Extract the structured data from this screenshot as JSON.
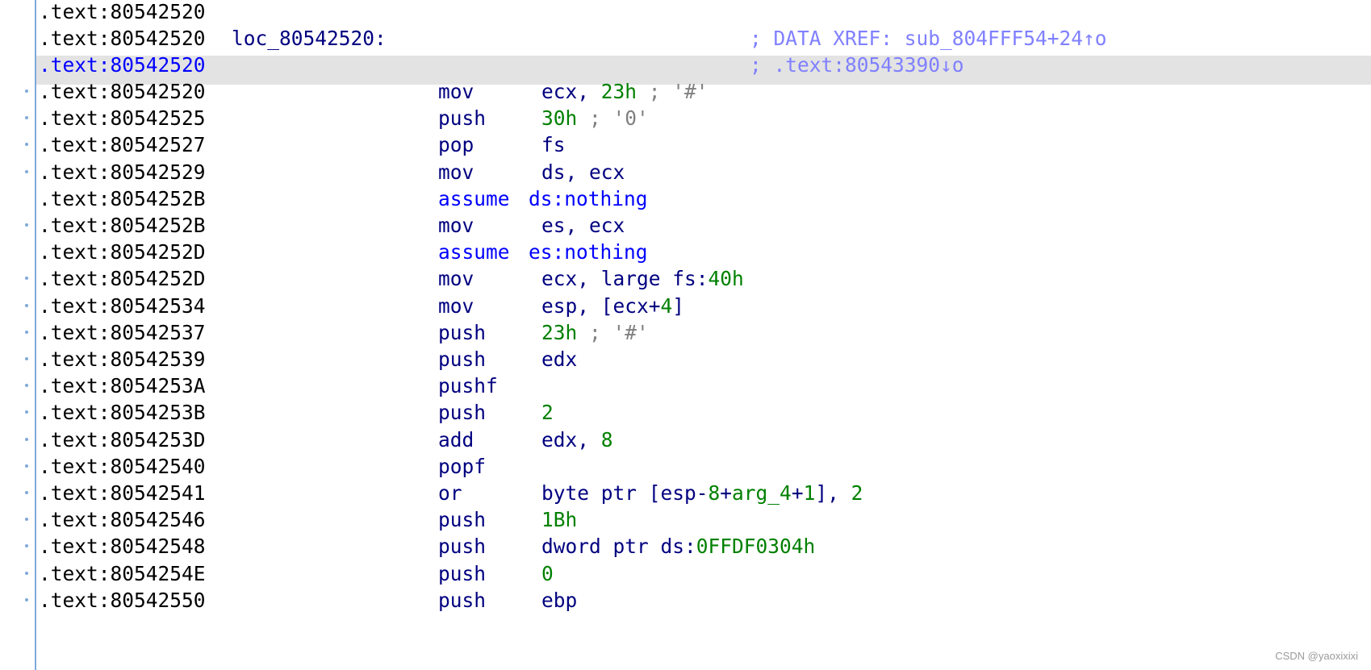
{
  "listing": {
    "header_rows": [
      {
        "address": ".text:80542520",
        "label": "",
        "xref": ""
      },
      {
        "address": ".text:80542520",
        "label": "loc_80542520:",
        "xref": "; DATA XREF: sub_804FFF54+24↑o"
      },
      {
        "address": ".text:80542520",
        "label": "",
        "xref": "; .text:80543390↓o"
      }
    ],
    "instructions": [
      {
        "address": ".text:80542520",
        "mnemonic": "mov",
        "operands": [
          {
            "t": "ecx, ",
            "c": "reg"
          },
          {
            "t": "23h",
            "c": "num"
          },
          {
            "t": " ; '#'",
            "c": "cmt"
          }
        ]
      },
      {
        "address": ".text:80542525",
        "mnemonic": "push",
        "operands": [
          {
            "t": "30h",
            "c": "num"
          },
          {
            "t": " ; '0'",
            "c": "cmt"
          }
        ]
      },
      {
        "address": ".text:80542527",
        "mnemonic": "pop",
        "operands": [
          {
            "t": "fs",
            "c": "reg"
          }
        ]
      },
      {
        "address": ".text:80542529",
        "mnemonic": "mov",
        "operands": [
          {
            "t": "ds, ecx",
            "c": "reg"
          }
        ]
      },
      {
        "address": ".text:8054252B",
        "mnemonic": "assume",
        "keyword": true,
        "operands": [
          {
            "t": "ds:nothing",
            "c": "kw"
          }
        ]
      },
      {
        "address": ".text:8054252B",
        "mnemonic": "mov",
        "operands": [
          {
            "t": "es, ecx",
            "c": "reg"
          }
        ]
      },
      {
        "address": ".text:8054252D",
        "mnemonic": "assume",
        "keyword": true,
        "operands": [
          {
            "t": "es:nothing",
            "c": "kw"
          }
        ]
      },
      {
        "address": ".text:8054252D",
        "mnemonic": "mov",
        "operands": [
          {
            "t": "ecx, large fs:",
            "c": "reg"
          },
          {
            "t": "40h",
            "c": "num"
          }
        ]
      },
      {
        "address": ".text:80542534",
        "mnemonic": "mov",
        "operands": [
          {
            "t": "esp, [ecx+",
            "c": "reg"
          },
          {
            "t": "4",
            "c": "num"
          },
          {
            "t": "]",
            "c": "reg"
          }
        ]
      },
      {
        "address": ".text:80542537",
        "mnemonic": "push",
        "operands": [
          {
            "t": "23h",
            "c": "num"
          },
          {
            "t": " ; '#'",
            "c": "cmt"
          }
        ]
      },
      {
        "address": ".text:80542539",
        "mnemonic": "push",
        "operands": [
          {
            "t": "edx",
            "c": "reg"
          }
        ]
      },
      {
        "address": ".text:8054253A",
        "mnemonic": "pushf",
        "operands": []
      },
      {
        "address": ".text:8054253B",
        "mnemonic": "push",
        "operands": [
          {
            "t": "2",
            "c": "num"
          }
        ]
      },
      {
        "address": ".text:8054253D",
        "mnemonic": "add",
        "operands": [
          {
            "t": "edx, ",
            "c": "reg"
          },
          {
            "t": "8",
            "c": "num"
          }
        ]
      },
      {
        "address": ".text:80542540",
        "mnemonic": "popf",
        "operands": []
      },
      {
        "address": ".text:80542541",
        "mnemonic": "or",
        "operands": [
          {
            "t": "byte ptr [esp-",
            "c": "reg"
          },
          {
            "t": "8",
            "c": "num"
          },
          {
            "t": "+",
            "c": "reg"
          },
          {
            "t": "arg_4",
            "c": "num"
          },
          {
            "t": "+",
            "c": "reg"
          },
          {
            "t": "1",
            "c": "num"
          },
          {
            "t": "], ",
            "c": "reg"
          },
          {
            "t": "2",
            "c": "num"
          }
        ]
      },
      {
        "address": ".text:80542546",
        "mnemonic": "push",
        "operands": [
          {
            "t": "1Bh",
            "c": "num"
          }
        ]
      },
      {
        "address": ".text:80542548",
        "mnemonic": "push",
        "operands": [
          {
            "t": "dword ptr ds:",
            "c": "reg"
          },
          {
            "t": "0FFDF0304h",
            "c": "num"
          }
        ]
      },
      {
        "address": ".text:8054254E",
        "mnemonic": "push",
        "operands": [
          {
            "t": "0",
            "c": "num"
          }
        ]
      },
      {
        "address": ".text:80542550",
        "mnemonic": "push",
        "operands": [
          {
            "t": "ebp",
            "c": "reg"
          }
        ]
      }
    ]
  },
  "watermark": "CSDN @yaoxixixi",
  "colors": {
    "address": "#000000",
    "selected_address": "#0000ff",
    "mnemonic": "#000080",
    "directive": "#0000ff",
    "number": "#008000",
    "comment": "#808080",
    "xref": "#8080ff",
    "highlight": "#e3e3e3",
    "gutter": "#7fa9d8"
  }
}
